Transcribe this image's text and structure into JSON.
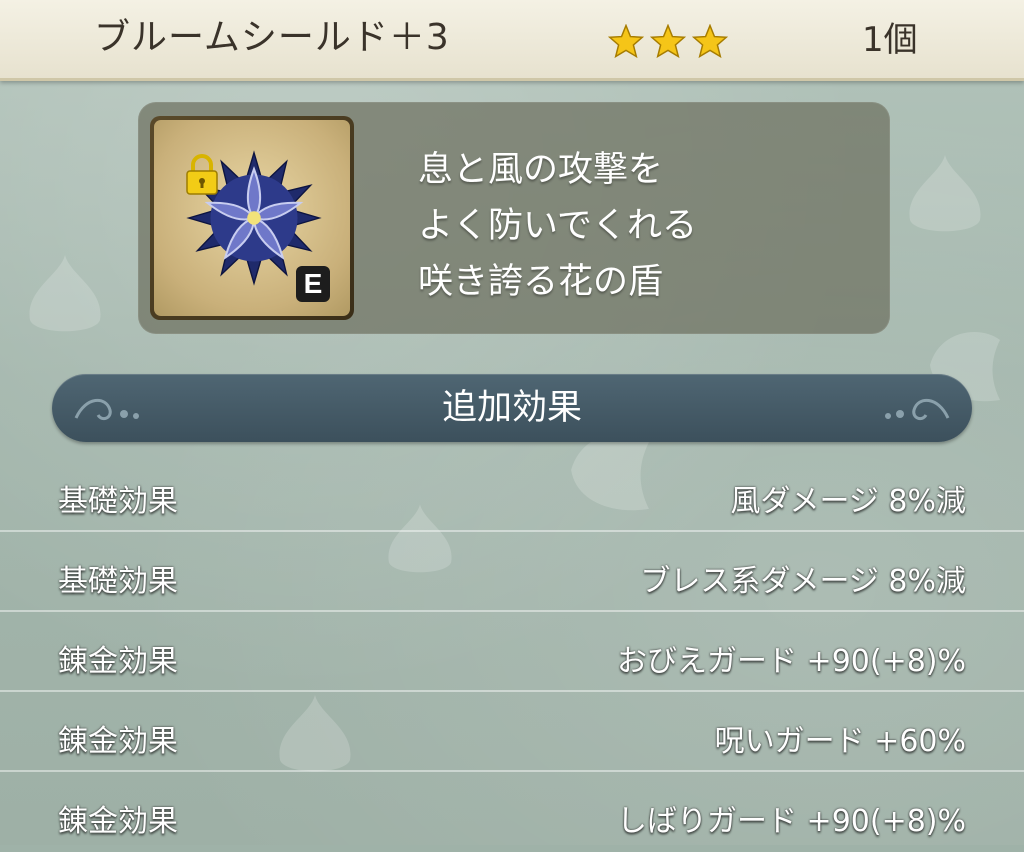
{
  "item": {
    "name": "ブルームシールド＋3",
    "rarity_stars": 3,
    "count": "1個",
    "icon": "blue-flower-shield-icon",
    "locked": true,
    "equipped_badge": "E",
    "description_lines": [
      "息と風の攻撃を",
      "よく防いでくれる",
      "咲き誇る花の盾"
    ]
  },
  "section": {
    "title": "追加効果"
  },
  "effects": [
    {
      "label": "基礎効果",
      "value": "風ダメージ  8%減"
    },
    {
      "label": "基礎効果",
      "value": "ブレス系ダメージ  8%減"
    },
    {
      "label": "錬金効果",
      "value": "おびえガード  +90(+8)%"
    },
    {
      "label": "錬金効果",
      "value": "呪いガード  +60%"
    },
    {
      "label": "錬金効果",
      "value": "しばりガード  +90(+8)%"
    }
  ],
  "colors": {
    "header_bg": "#f0ecdc",
    "star": "#f5c518",
    "banner_bg": "#465b67",
    "background": "#a3b6ac"
  }
}
